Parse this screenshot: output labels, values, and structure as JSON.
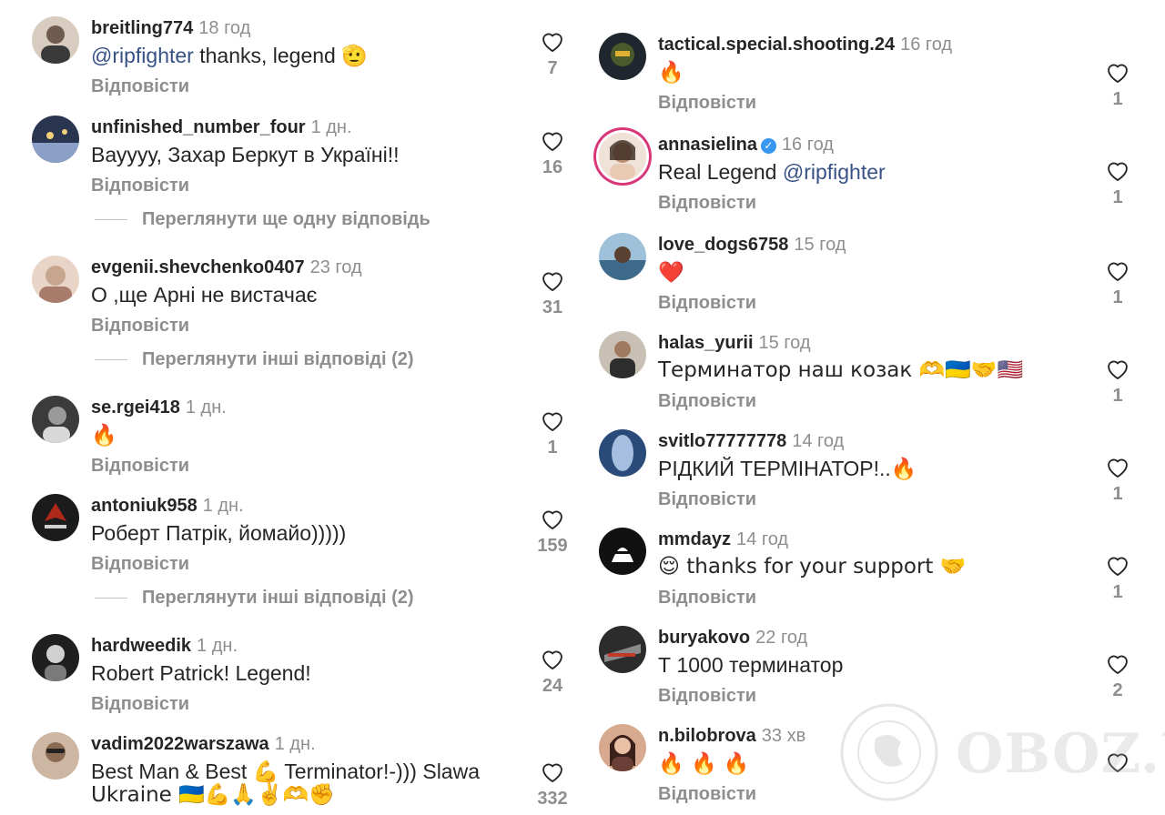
{
  "common": {
    "reply_label": "Відповісти"
  },
  "left_comments": [
    {
      "username": "breitling774",
      "time": "18 год",
      "mention": "@ripfighter",
      "text": " thanks, legend ",
      "emoji": "🫡",
      "likes": "7",
      "avatar_color": "#6f5b4e",
      "avatar_bg": "#d8cbbf"
    },
    {
      "username": "unfinished_number_four",
      "time": "1 дн.",
      "mention": "",
      "text": "Вауууу, Захар Беркут в Україні!!",
      "emoji": "",
      "likes": "16",
      "avatar_color": "#2a3550",
      "avatar_bg": "#8aa0c6"
    },
    {
      "username": "evgenii.shevchenko0407",
      "time": "23 год",
      "mention": "",
      "text": "О ,ще Арні не вистачає",
      "emoji": "",
      "likes": "31",
      "avatar_color": "#c7a68f",
      "avatar_bg": "#e9d4c8"
    },
    {
      "username": "se.rgei418",
      "time": "1 дн.",
      "mention": "",
      "text": "",
      "emoji": "🔥",
      "likes": "1",
      "avatar_color": "#3b3b3b",
      "avatar_bg": "#9a9a9a"
    },
    {
      "username": "antoniuk958",
      "time": "1 дн.",
      "mention": "",
      "text": "Роберт Патрік, йомайо)))))",
      "emoji": "",
      "likes": "159",
      "avatar_color": "#b0281a",
      "avatar_bg": "#1b1b1b"
    },
    {
      "username": "hardweedik",
      "time": "1 дн.",
      "mention": "",
      "text": "Robert Patrick! Legend!",
      "emoji": "",
      "likes": "24",
      "avatar_color": "#d0d0d0",
      "avatar_bg": "#1f1f1f"
    },
    {
      "username": "vadim2022warszawa",
      "time": "1 дн.",
      "mention": "",
      "text": "Best Man & Best 💪 Terminator!-))) Slawa",
      "text2": "Ukraine 🇺🇦💪🙏✌️🫶✊",
      "emoji": "",
      "likes": "332",
      "avatar_color": "#8a6a50",
      "avatar_bg": "#cdb7a3"
    }
  ],
  "left_view_replies": [
    {
      "label": "Переглянути ще одну відповідь"
    },
    {
      "label": "Переглянути інші відповіді (2)"
    },
    {
      "label": "Переглянути інші відповіді (2)"
    }
  ],
  "right_comments": [
    {
      "username": "tactical.special.shooting.24",
      "time": "16 год",
      "mention": "",
      "text": "",
      "emoji": "🔥",
      "likes": "1",
      "avatar_color": "#4a5a2c",
      "avatar_bg": "#20262e"
    },
    {
      "username": "annasielina",
      "time": "16 год",
      "verified": true,
      "mention": "@ripfighter",
      "text": "Real Legend ",
      "emoji": "",
      "likes": "1",
      "avatar_color": "#b98c70",
      "avatar_bg": "#efe2d6"
    },
    {
      "username": "love_dogs6758",
      "time": "15 год",
      "mention": "",
      "text": "",
      "emoji": "❤️",
      "likes": "1",
      "avatar_color": "#3d6a8a",
      "avatar_bg": "#9ec0d8"
    },
    {
      "username": "halas_yurii",
      "time": "15 год",
      "mention": "",
      "text": "Терминатор наш козак 🫶🇺🇦🤝🇺🇸",
      "emoji": "",
      "likes": "1",
      "avatar_color": "#2d2d2d",
      "avatar_bg": "#c8c0b4"
    },
    {
      "username": "svitlo77777778",
      "time": "14 год",
      "mention": "",
      "text": "РІДКИЙ ТЕРМІНАТОР!..",
      "emoji": "🔥",
      "likes": "1",
      "avatar_color": "#bcd4f2",
      "avatar_bg": "#2a4a7a"
    },
    {
      "username": "mmdayz",
      "time": "14 год",
      "mention": "",
      "text": "😌 thanks for your support 🤝",
      "emoji": "",
      "likes": "1",
      "avatar_color": "#ffffff",
      "avatar_bg": "#111111"
    },
    {
      "username": "buryakovo",
      "time": "22 год",
      "mention": "",
      "text": "Т 1000  терминатор",
      "emoji": "",
      "likes": "2",
      "avatar_color": "#8a8a8a",
      "avatar_bg": "#2c2c2c"
    },
    {
      "username": "n.bilobrova",
      "time": "33 хв",
      "mention": "",
      "text": "",
      "emoji": "🔥 🔥 🔥",
      "likes": "",
      "avatar_color": "#6a3f36",
      "avatar_bg": "#d7a98f"
    }
  ],
  "watermark": {
    "text": "OBOZ.UA"
  }
}
